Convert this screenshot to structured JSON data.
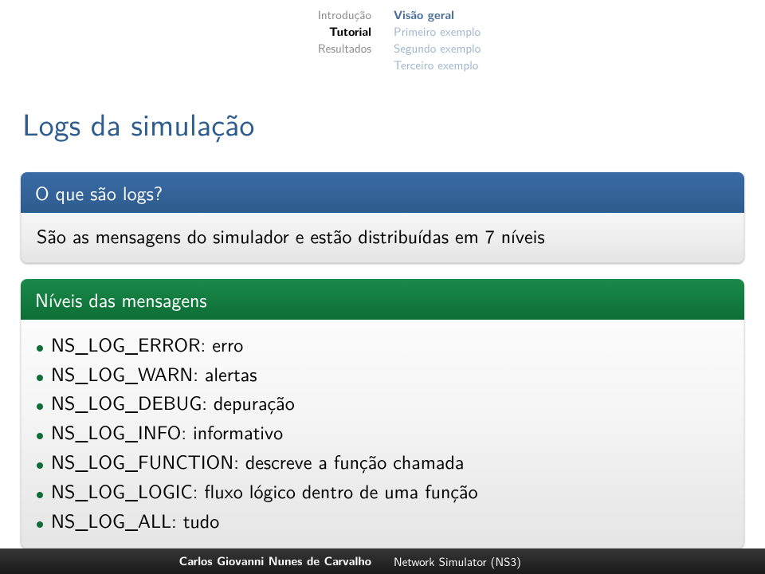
{
  "header": {
    "sections": [
      "Introdução",
      "Tutorial",
      "Resultados"
    ],
    "active_section_index": 1,
    "subsections": [
      "Visão geral",
      "Primeiro exemplo",
      "Segundo exemplo",
      "Terceiro exemplo"
    ],
    "active_subsection_index": 0
  },
  "title": "Logs da simulação",
  "block1": {
    "title": "O que são logs?",
    "body": "São as mensagens do simulador e estão distribuídas em 7 níveis"
  },
  "block2": {
    "title": "Níveis das mensagens",
    "items": [
      "NS_LOG_ERROR: erro",
      "NS_LOG_WARN: alertas",
      "NS_LOG_DEBUG: depuração",
      "NS_LOG_INFO: informativo",
      "NS_LOG_FUNCTION: descreve a função chamada",
      "NS_LOG_LOGIC: fluxo lógico dentro de uma função",
      "NS_LOG_ALL: tudo"
    ]
  },
  "footer": {
    "author": "Carlos Giovanni Nunes de Carvalho",
    "presentation": "Network Simulator (NS3)"
  }
}
